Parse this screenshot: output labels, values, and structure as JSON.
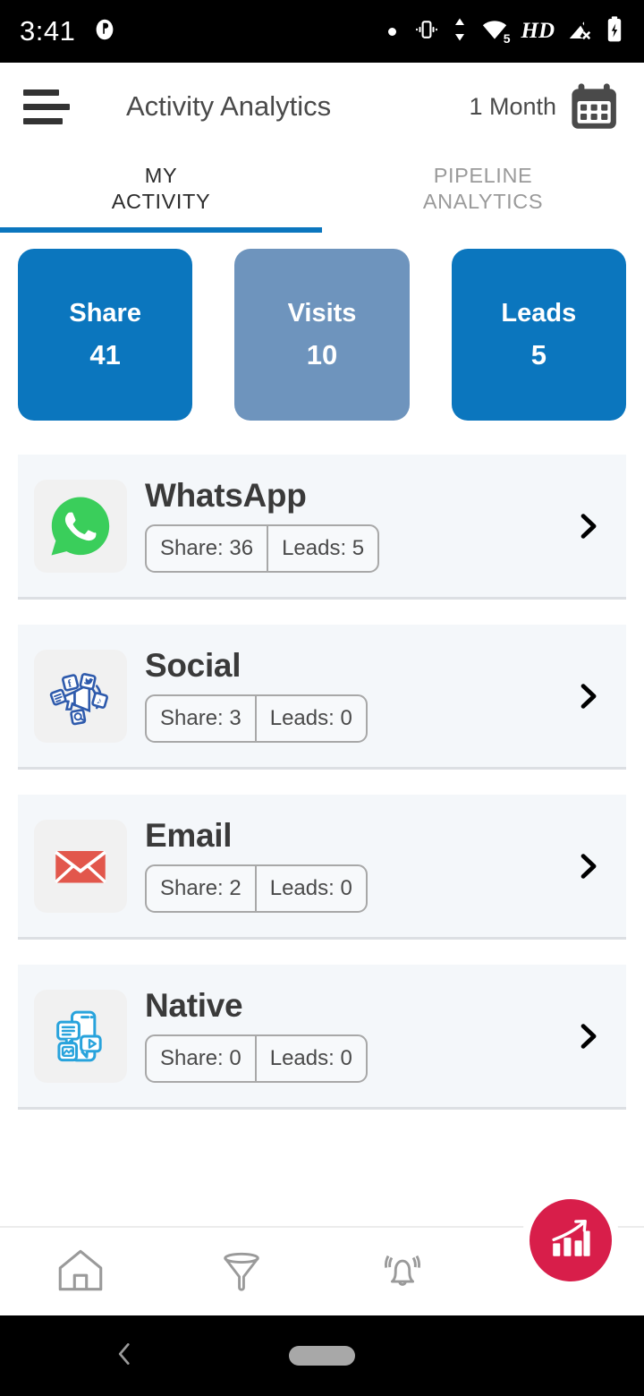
{
  "status_bar": {
    "time": "3:41",
    "hd_label": "HD",
    "wifi_level": "5",
    "icons": [
      "app-notification-icon",
      "dot-icon",
      "vibrate-icon",
      "data-transfer-icon",
      "wifi-icon",
      "hd-icon",
      "signal-no-service-icon",
      "battery-charging-icon"
    ]
  },
  "app_bar": {
    "title": "Activity Analytics",
    "period_label": "1 Month",
    "menu_icon": "hamburger-icon",
    "calendar_icon": "calendar-icon"
  },
  "tabs": [
    {
      "label": "MY\nACTIVITY",
      "line1": "MY",
      "line2": "ACTIVITY",
      "active": true
    },
    {
      "label": "PIPELINE\nANALYTICS",
      "line1": "PIPELINE",
      "line2": "ANALYTICS",
      "active": false
    }
  ],
  "stat_cards": [
    {
      "label": "Share",
      "value": "41",
      "color": "#0B76BE"
    },
    {
      "label": "Visits",
      "value": "10",
      "color": "#6E94BD"
    },
    {
      "label": "Leads",
      "value": "5",
      "color": "#0B76BE"
    }
  ],
  "channels": [
    {
      "name": "WhatsApp",
      "icon": "whatsapp-icon",
      "share": "Share: 36",
      "leads": "Leads: 5"
    },
    {
      "name": "Social",
      "icon": "social-megaphone-icon",
      "share": "Share: 3",
      "leads": "Leads: 0"
    },
    {
      "name": "Email",
      "icon": "email-envelope-icon",
      "share": "Share: 2",
      "leads": "Leads: 0"
    },
    {
      "name": "Native",
      "icon": "native-app-icon",
      "share": "Share: 0",
      "leads": "Leads: 0"
    }
  ],
  "bottom_nav": [
    {
      "name": "home-icon"
    },
    {
      "name": "funnel-icon"
    },
    {
      "name": "bell-icon"
    }
  ],
  "fab": {
    "icon": "bar-chart-growth-icon",
    "color": "#D81E4A"
  },
  "android_nav": {
    "back_icon": "back-chevron-icon",
    "home_pill": "home-indicator-pill"
  },
  "theme": {
    "primary_blue": "#0B76BE",
    "muted_blue": "#6E94BD",
    "row_bg": "#F4F7FA",
    "accent_red": "#D81E4A"
  }
}
